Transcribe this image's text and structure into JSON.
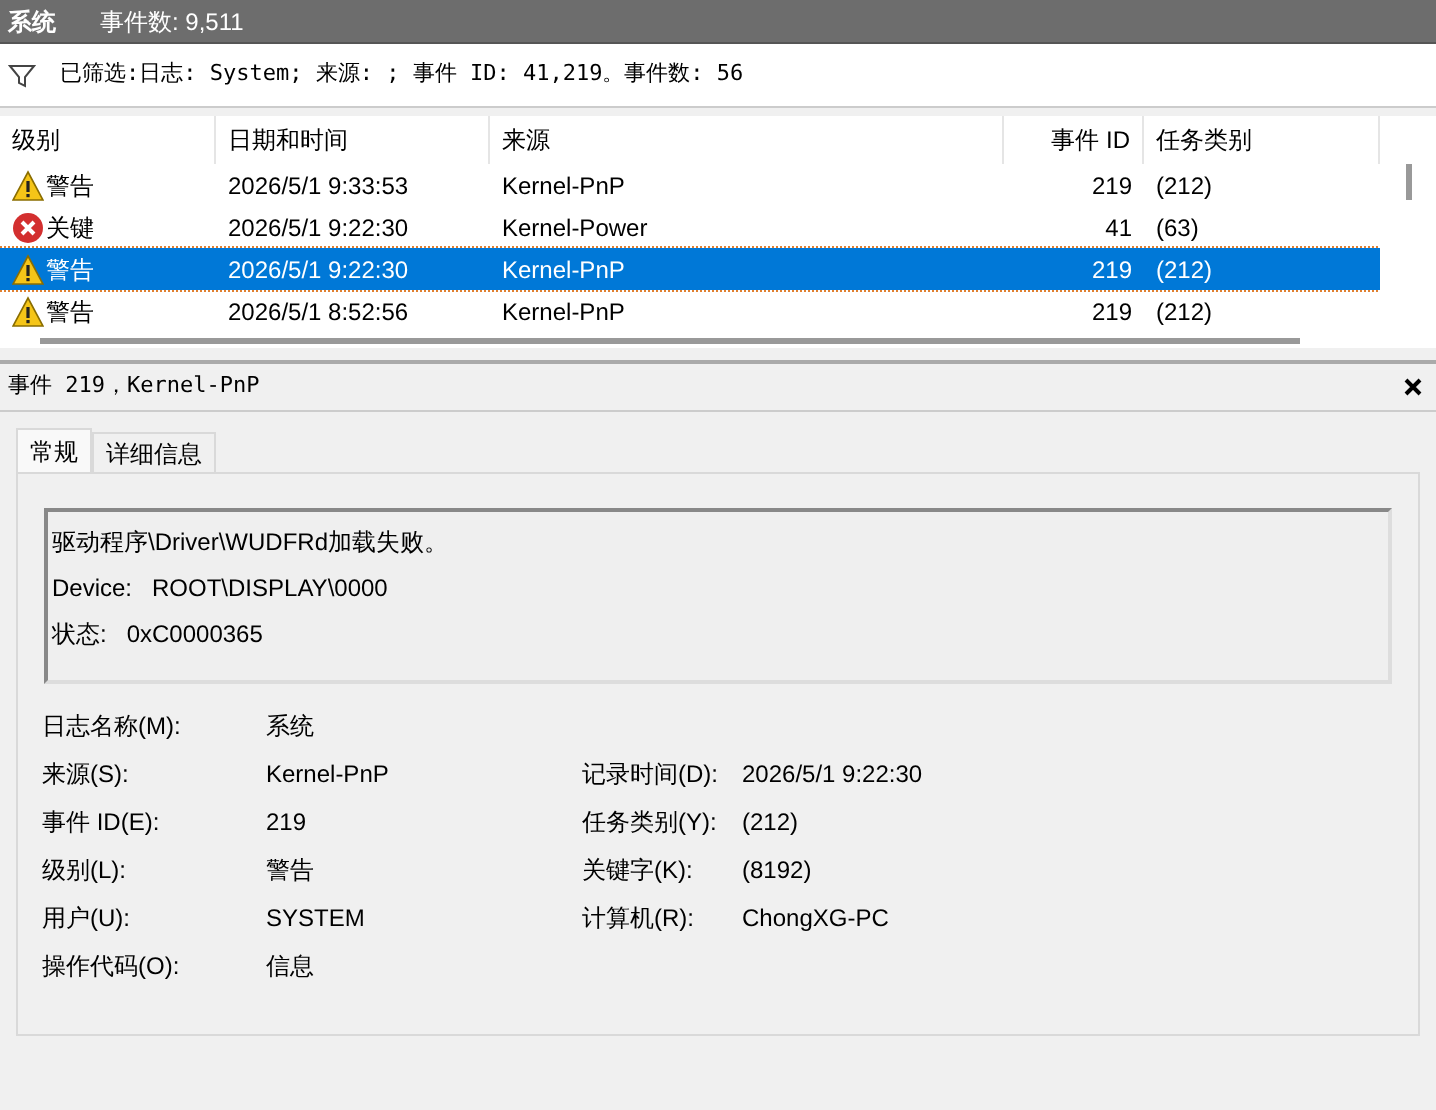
{
  "header": {
    "title": "系统",
    "count": "事件数: 9,511"
  },
  "filter": {
    "text": "已筛选:日志: System; 来源: ; 事件 ID: 41,219。事件数: 56"
  },
  "table": {
    "columns": [
      "级别",
      "日期和时间",
      "来源",
      "事件 ID",
      "任务类别"
    ],
    "rows": [
      {
        "level": "警告",
        "kind": "warning",
        "date": "2026/5/1 9:33:53",
        "source": "Kernel-PnP",
        "id": "219",
        "task": "(212)",
        "selected": false
      },
      {
        "level": "关键",
        "kind": "critical",
        "date": "2026/5/1 9:22:30",
        "source": "Kernel-Power",
        "id": "41",
        "task": "(63)",
        "selected": false
      },
      {
        "level": "警告",
        "kind": "warning",
        "date": "2026/5/1 9:22:30",
        "source": "Kernel-PnP",
        "id": "219",
        "task": "(212)",
        "selected": true
      },
      {
        "level": "警告",
        "kind": "warning",
        "date": "2026/5/1 8:52:56",
        "source": "Kernel-PnP",
        "id": "219",
        "task": "(212)",
        "selected": false
      }
    ]
  },
  "detail": {
    "title": "事件 219，Kernel-PnP",
    "tabs": [
      {
        "label": "常规",
        "selected": true
      },
      {
        "label": "详细信息",
        "selected": false
      }
    ],
    "message": [
      "驱动程序\\Driver\\WUDFRd加载失败。",
      "Device:   ROOT\\DISPLAY\\0000",
      "状态:   0xC0000365"
    ],
    "properties": [
      [
        {
          "label": "日志名称(M):",
          "value": "系统"
        }
      ],
      [
        {
          "label": "来源(S):",
          "value": "Kernel-PnP"
        },
        {
          "label": "记录时间(D):",
          "value": "2026/5/1 9:22:30"
        }
      ],
      [
        {
          "label": "事件 ID(E):",
          "value": "219"
        },
        {
          "label": "任务类别(Y):",
          "value": "(212)"
        }
      ],
      [
        {
          "label": "级别(L):",
          "value": "警告"
        },
        {
          "label": "关键字(K):",
          "value": "(8192)"
        }
      ],
      [
        {
          "label": "用户(U):",
          "value": "SYSTEM"
        },
        {
          "label": "计算机(R):",
          "value": "ChongXG-PC"
        }
      ],
      [
        {
          "label": "操作代码(O):",
          "value": "信息"
        }
      ]
    ]
  }
}
